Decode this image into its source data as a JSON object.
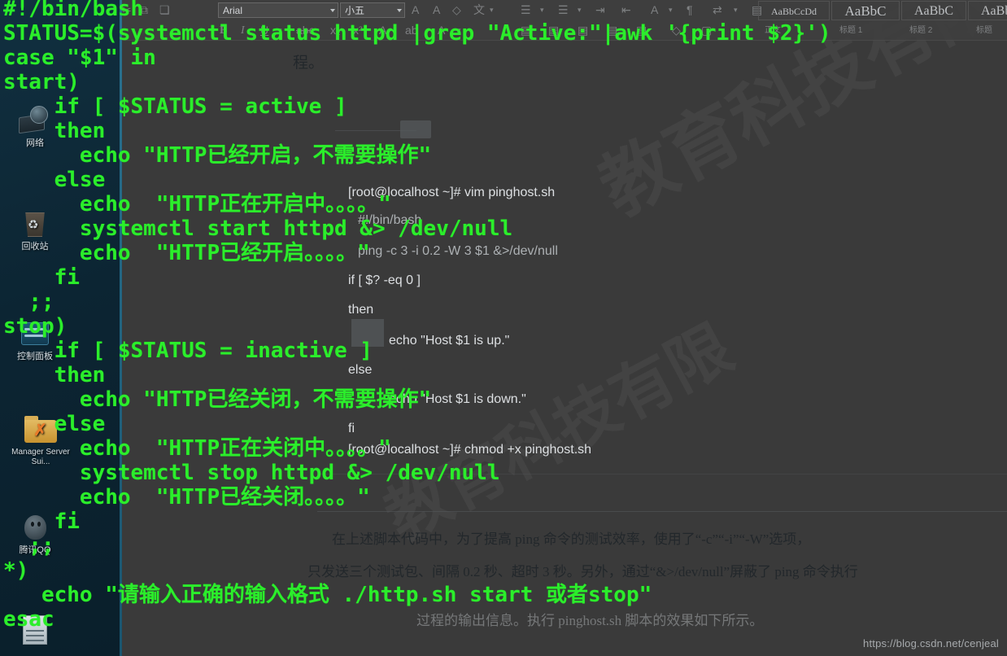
{
  "watermark": {
    "csdn_url": "https://blog.csdn.net/cenjeal",
    "page_ghost": "教育科技有限"
  },
  "desktop": {
    "icons": [
      {
        "name": "network",
        "label": "网络"
      },
      {
        "name": "recycle-bin",
        "label": "回收站"
      },
      {
        "name": "control-panel",
        "label": "控制面板"
      },
      {
        "name": "manager-folder",
        "label": "Manager Server Sui..."
      },
      {
        "name": "qq",
        "label": "腾讯QQ"
      },
      {
        "name": "document",
        "label": ""
      }
    ]
  },
  "ribbon": {
    "font_name": "Arial",
    "font_size": "小五",
    "icons_row1": [
      "剪切",
      "复制",
      "格式刷",
      "A",
      "A",
      "清除格式",
      "拼音"
    ],
    "icons_row2": [
      "B",
      "I",
      "U",
      "abc",
      "x₂",
      "x²",
      "A",
      "字符底纹",
      "A"
    ],
    "paragraph_icons": [
      "项目符号",
      "编号",
      "多级列表",
      "减少缩进",
      "增加缩进",
      "排序",
      "显示编辑标记",
      "左对齐",
      "居中",
      "右对齐",
      "两端对齐",
      "分散对齐"
    ],
    "styles": [
      {
        "preview": "AaBbCcDd",
        "label": "正文"
      },
      {
        "preview": "AaBbC",
        "label": "标题 1"
      },
      {
        "preview": "AaBbC",
        "label": "标题 2"
      },
      {
        "preview": "AaBbC",
        "label": "标题"
      }
    ]
  },
  "document": {
    "intro_fragment": "程。",
    "console_lines": [
      "[root@localhost ~]# vim pinghost.sh",
      "#!/bin/bash",
      "ping -c 3 -i 0.2 -W 3 $1 &>/dev/null",
      "if [ $? -eq 0 ]",
      "then",
      "echo \"Host $1 is up.\"",
      "else",
      "echo \"Host $1 is down.\"",
      "fi",
      "[root@localhost ~]# chmod +x pinghost.sh"
    ],
    "paragraphs": [
      "在上述脚本代码中，为了提高 ping 命令的测试效率，使用了“-c”“-i”“-W”选项，",
      "只发送三个测试包、间隔 0.2 秒、超时 3 秒。另外，通过“&>/dev/null”屏蔽了 ping 命令执行",
      "过程的输出信息。执行 pinghost.sh 脚本的效果如下所示。"
    ]
  },
  "terminal": {
    "language": "bash",
    "lines": [
      "#!/bin/bash",
      "STATUS=$(systemctl status httpd |grep \"Active:\"|awk '{print $2}')",
      "case \"$1\" in",
      "start)",
      "    if [ $STATUS = active ]",
      "    then",
      "      echo \"HTTP已经开启，不需要操作\"",
      "    else",
      "      echo  \"HTTP正在开启中。。。。\"",
      "      systemctl start httpd &> /dev/null",
      "      echo  \"HTTP已经开启。。。。\"",
      "    fi",
      "  ;;",
      "stop)",
      "    if [ $STATUS = inactive ]",
      "    then",
      "      echo \"HTTP已经关闭，不需要操作\"",
      "    else",
      "      echo  \"HTTP正在关闭中。。。。\"",
      "      systemctl stop httpd &> /dev/null",
      "      echo  \"HTTP已经关闭。。。。\"",
      "    fi",
      "  ;;",
      "*)",
      "   echo \"请输入正确的输入格式 ./http.sh start 或者stop\"",
      "esac"
    ]
  },
  "colors": {
    "terminal_green": "#2bee2b",
    "doc_background": "#3a3a3a",
    "desktop_background": "#0c2533",
    "ribbon_background": "#3f3f3f"
  }
}
